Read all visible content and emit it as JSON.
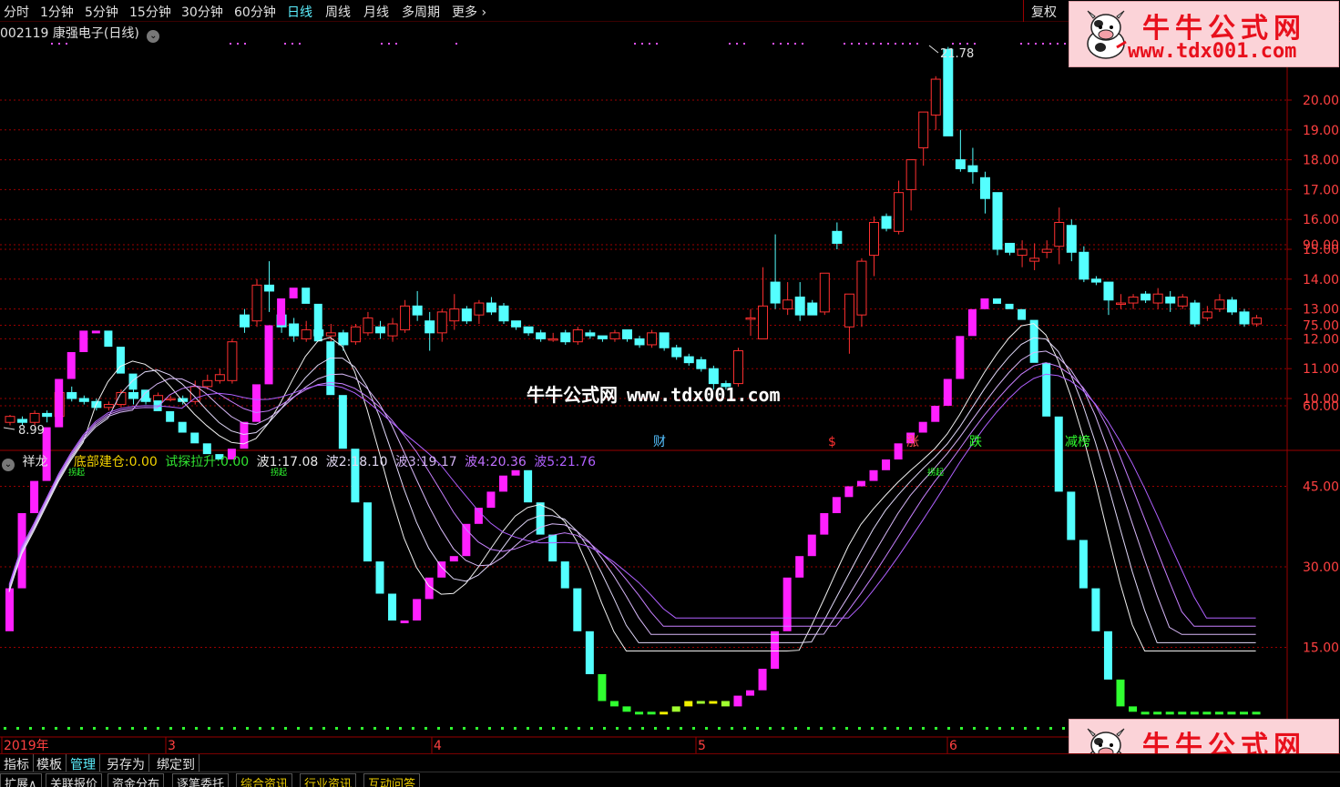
{
  "toolbar": {
    "periods": [
      "分时",
      "1分钟",
      "5分钟",
      "15分钟",
      "30分钟",
      "60分钟",
      "日线",
      "周线",
      "月线",
      "多周期",
      "更多"
    ],
    "active_period": "日线",
    "restore_label": "复权"
  },
  "stock": {
    "code": "002119",
    "name": "康强电子",
    "period_label": "(日线)"
  },
  "price_axis": [
    "20.00",
    "19.00",
    "18.00",
    "17.00",
    "16.00",
    "15.00",
    "14.00",
    "13.00",
    "12.00",
    "11.00",
    "10.00"
  ],
  "price_high_label": "21.78",
  "price_low_label": "8.99",
  "event_markers": [
    "财",
    "$",
    "涨",
    "跌",
    "减榜"
  ],
  "indicator": {
    "name": "祥龙",
    "fields": [
      {
        "label": "底部建仓:",
        "value": "0.00"
      },
      {
        "label": "试探拉升:",
        "value": "0.00"
      },
      {
        "label": "波1:",
        "value": "17.08"
      },
      {
        "label": "波2:",
        "value": "18.10"
      },
      {
        "label": "波3:",
        "value": "19.17"
      },
      {
        "label": "波4:",
        "value": "20.36"
      },
      {
        "label": "波5:",
        "value": "21.76"
      }
    ],
    "axis": [
      "90.00",
      "75.00",
      "60.00",
      "45.00",
      "30.00",
      "15.00"
    ],
    "signal_label": "拐起"
  },
  "date_axis": [
    "2019年",
    "3",
    "4",
    "5",
    "5",
    "6"
  ],
  "bottom_tabs": [
    "指标",
    "模板",
    "管理",
    "另存为",
    "绑定到"
  ],
  "active_bottom_tab": "管理",
  "info_tabs": [
    "扩展∧",
    "关联报价",
    "资金分布",
    "逐笔委托",
    "综合资讯",
    "行业资讯",
    "互动问答"
  ],
  "logo": {
    "title": "牛牛公式网",
    "url": "www.tdx001.com"
  },
  "watermark": {
    "title": "牛牛公式网",
    "url": "www.tdx001.com"
  },
  "colors": {
    "up": "#ff3030",
    "down": "#54ffff",
    "background": "#000000",
    "grid": "#9a0000",
    "wave": "#c060ff"
  },
  "chart_data": {
    "type": "candlestick",
    "title": "002119 康强电子 (日线)",
    "ylim": [
      8.99,
      21.78
    ],
    "candles": [
      [
        9.2,
        9.4,
        9.1,
        9.45
      ],
      [
        9.3,
        9.2,
        9.1,
        9.4
      ],
      [
        9.2,
        9.5,
        9.1,
        9.6
      ],
      [
        9.5,
        9.4,
        9.2,
        9.6
      ],
      [
        9.4,
        10.2,
        9.3,
        10.3
      ],
      [
        10.2,
        10.0,
        9.9,
        10.4
      ],
      [
        10.0,
        9.9,
        9.8,
        10.1
      ],
      [
        9.9,
        9.7,
        9.6,
        10.0
      ],
      [
        9.7,
        9.8,
        9.6,
        9.9
      ],
      [
        9.8,
        10.2,
        9.7,
        10.3
      ],
      [
        10.2,
        10.0,
        9.8,
        10.3
      ],
      [
        10.0,
        9.9,
        9.8,
        10.1
      ],
      [
        9.9,
        10.1,
        9.8,
        10.2
      ],
      [
        10.0,
        10.0,
        9.9,
        10.1
      ],
      [
        10.0,
        9.9,
        9.8,
        10.1
      ],
      [
        9.9,
        10.4,
        9.8,
        10.6
      ],
      [
        10.4,
        10.6,
        10.3,
        10.8
      ],
      [
        10.6,
        10.8,
        10.5,
        11.0
      ],
      [
        10.6,
        11.9,
        10.5,
        12.0
      ],
      [
        12.8,
        12.4,
        12.2,
        13.0
      ],
      [
        12.6,
        13.8,
        12.4,
        14.0
      ],
      [
        13.8,
        13.6,
        12.9,
        14.6
      ],
      [
        12.8,
        12.4,
        12.2,
        13.2
      ],
      [
        12.5,
        12.1,
        11.9,
        12.7
      ],
      [
        12.0,
        12.3,
        11.9,
        12.6
      ],
      [
        12.3,
        12.1,
        12.0,
        12.4
      ],
      [
        12.1,
        12.2,
        11.8,
        12.5
      ],
      [
        12.2,
        11.8,
        11.6,
        12.3
      ],
      [
        11.9,
        12.4,
        11.8,
        12.5
      ],
      [
        12.2,
        12.7,
        12.1,
        12.9
      ],
      [
        12.4,
        12.2,
        12.0,
        12.6
      ],
      [
        12.1,
        12.5,
        11.9,
        12.7
      ],
      [
        12.3,
        13.1,
        12.2,
        13.3
      ],
      [
        13.1,
        12.8,
        12.6,
        13.6
      ],
      [
        12.6,
        12.2,
        11.6,
        12.9
      ],
      [
        12.2,
        12.9,
        11.9,
        13.0
      ],
      [
        12.6,
        13.0,
        12.3,
        13.5
      ],
      [
        13.0,
        12.6,
        12.5,
        13.1
      ],
      [
        12.8,
        13.2,
        12.5,
        13.3
      ],
      [
        13.2,
        12.9,
        12.8,
        13.4
      ],
      [
        13.1,
        12.6,
        12.5,
        13.2
      ],
      [
        12.6,
        12.4,
        12.3,
        12.6
      ],
      [
        12.4,
        12.2,
        12.1,
        12.3
      ],
      [
        12.2,
        12.0,
        11.9,
        12.3
      ],
      [
        12.0,
        12.0,
        11.9,
        12.2
      ],
      [
        12.2,
        11.9,
        11.8,
        12.3
      ],
      [
        11.9,
        12.3,
        11.8,
        12.4
      ],
      [
        12.2,
        12.1,
        12.0,
        12.3
      ],
      [
        12.1,
        12.0,
        11.9,
        12.1
      ],
      [
        12.0,
        12.2,
        11.9,
        12.3
      ],
      [
        12.3,
        12.0,
        11.9,
        12.3
      ],
      [
        12.0,
        11.8,
        11.7,
        12.1
      ],
      [
        11.8,
        12.2,
        11.7,
        12.3
      ],
      [
        12.2,
        11.7,
        11.6,
        12.2
      ],
      [
        11.7,
        11.4,
        11.3,
        11.8
      ],
      [
        11.4,
        11.2,
        11.1,
        11.5
      ],
      [
        11.3,
        11.0,
        10.9,
        11.4
      ],
      [
        11.0,
        10.5,
        10.3,
        11.1
      ],
      [
        10.5,
        10.4,
        10.3,
        10.6
      ],
      [
        10.5,
        11.6,
        10.4,
        11.7
      ],
      [
        12.7,
        12.7,
        12.1,
        13.0
      ],
      [
        12.0,
        13.1,
        12.0,
        14.4
      ],
      [
        13.9,
        13.2,
        13.0,
        15.5
      ],
      [
        13.0,
        13.3,
        12.8,
        13.9
      ],
      [
        13.4,
        12.8,
        12.6,
        13.9
      ],
      [
        13.2,
        12.8,
        12.8,
        13.3
      ],
      [
        12.9,
        14.2,
        12.8,
        14.2
      ],
      [
        15.6,
        15.2,
        15.0,
        15.9
      ],
      [
        12.4,
        13.5,
        11.5,
        13.5
      ],
      [
        12.8,
        14.6,
        12.4,
        14.7
      ],
      [
        14.8,
        15.9,
        14.1,
        16.1
      ],
      [
        16.1,
        15.7,
        15.6,
        16.2
      ],
      [
        15.6,
        16.9,
        15.5,
        17.3
      ],
      [
        17.0,
        18.0,
        16.3,
        18.0
      ],
      [
        18.4,
        19.6,
        17.8,
        19.6
      ],
      [
        19.5,
        20.7,
        19.0,
        20.8
      ],
      [
        21.7,
        18.8,
        18.8,
        21.78
      ],
      [
        18.0,
        17.7,
        17.6,
        19.0
      ],
      [
        17.8,
        17.6,
        17.2,
        18.4
      ],
      [
        17.4,
        16.7,
        16.2,
        17.6
      ],
      [
        16.9,
        15.0,
        14.8,
        15.4
      ],
      [
        15.2,
        14.9,
        14.8,
        15.2
      ],
      [
        14.8,
        15.0,
        14.4,
        15.3
      ],
      [
        14.6,
        14.7,
        14.3,
        15.2
      ],
      [
        14.9,
        15.0,
        14.7,
        15.3
      ],
      [
        15.1,
        15.9,
        14.5,
        16.4
      ],
      [
        15.8,
        14.9,
        14.6,
        16.0
      ],
      [
        14.9,
        14.0,
        13.9,
        15.1
      ],
      [
        14.0,
        13.9,
        13.8,
        14.1
      ],
      [
        13.9,
        13.3,
        12.8,
        13.4
      ],
      [
        13.2,
        13.2,
        13.0,
        13.5
      ],
      [
        13.2,
        13.4,
        13.0,
        13.5
      ],
      [
        13.5,
        13.3,
        13.2,
        13.6
      ],
      [
        13.2,
        13.5,
        13.0,
        13.7
      ],
      [
        13.4,
        13.2,
        12.9,
        13.6
      ],
      [
        13.1,
        13.4,
        13.0,
        13.5
      ],
      [
        13.2,
        12.5,
        12.4,
        13.3
      ],
      [
        12.7,
        12.9,
        12.6,
        13.1
      ],
      [
        13.0,
        13.3,
        12.9,
        13.5
      ],
      [
        13.3,
        12.9,
        12.8,
        13.4
      ],
      [
        12.9,
        12.5,
        12.4,
        13.0
      ],
      [
        12.5,
        12.7,
        12.4,
        12.8
      ]
    ],
    "indicator_series": {
      "name": "祥龙",
      "bars": [
        26,
        40,
        46,
        56,
        65,
        70,
        74,
        74,
        71,
        66,
        63,
        61,
        59,
        57,
        55,
        53,
        51,
        50,
        52,
        57,
        64,
        75,
        80,
        82,
        79,
        72,
        62,
        52,
        42,
        31,
        25,
        20,
        20,
        24,
        28,
        31,
        32,
        38,
        41,
        44,
        47,
        48,
        42,
        36,
        31,
        26,
        18,
        10,
        5,
        4,
        3,
        3,
        3,
        3,
        4,
        5,
        5,
        5,
        4,
        6,
        7,
        11,
        18,
        28,
        32,
        36,
        40,
        43,
        45,
        46,
        48,
        50,
        53,
        55,
        57,
        60,
        65,
        73,
        78,
        80,
        79,
        78,
        76,
        68,
        58,
        44,
        35,
        26,
        18,
        9,
        4,
        3,
        3,
        3,
        3,
        3,
        3,
        3,
        3,
        3,
        3,
        3
      ],
      "wave_lines": 5,
      "axis_range": [
        0,
        100
      ]
    }
  }
}
